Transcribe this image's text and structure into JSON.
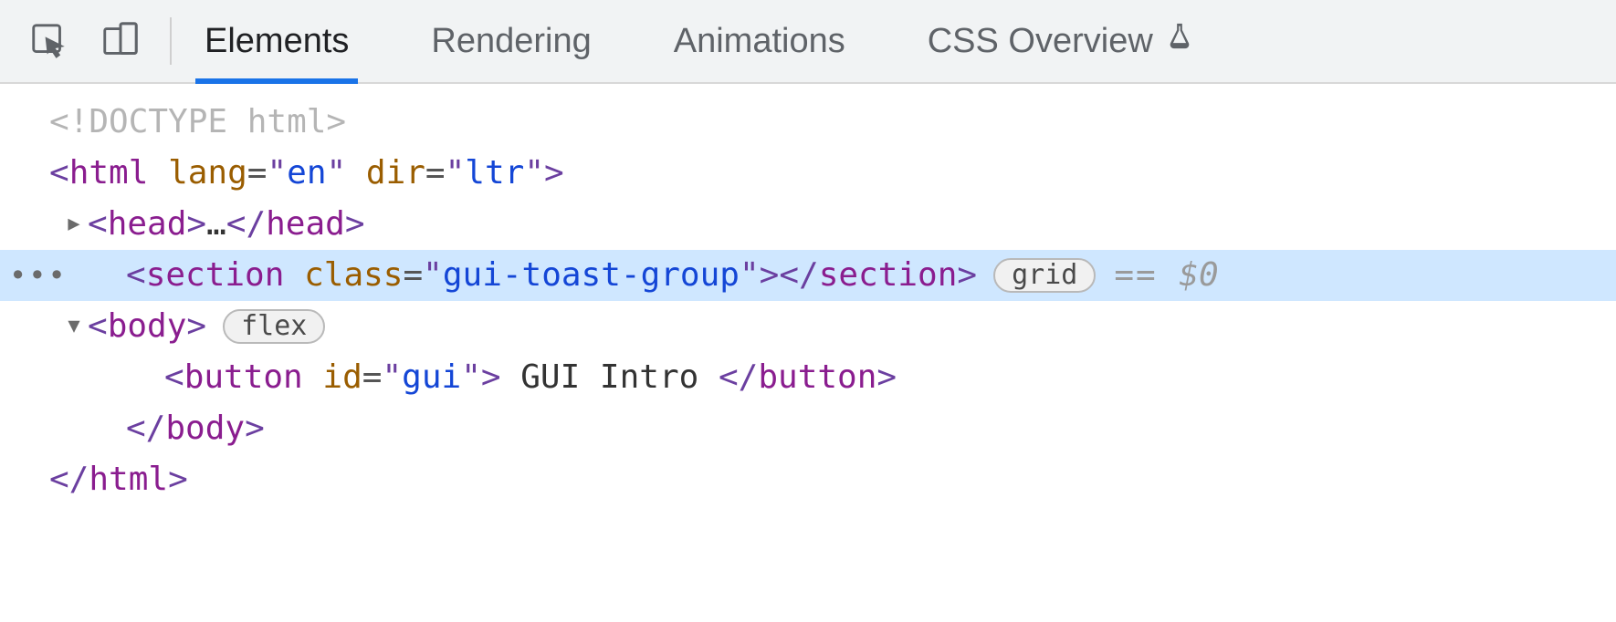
{
  "toolbar": {
    "tabs": {
      "elements": "Elements",
      "rendering": "Rendering",
      "animations": "Animations",
      "css_overview": "CSS Overview"
    }
  },
  "dom": {
    "doctype": "<!DOCTYPE html>",
    "html_open": {
      "tag": "html",
      "lang_attr": "lang",
      "lang_val": "en",
      "dir_attr": "dir",
      "dir_val": "ltr"
    },
    "head": {
      "tag_open": "head",
      "ellipsis": "…",
      "tag_close": "head"
    },
    "section": {
      "tag": "section",
      "class_attr": "class",
      "class_val": "gui-toast-group",
      "badge": "grid",
      "ref": "== $0"
    },
    "body_open": {
      "tag": "body",
      "badge": "flex"
    },
    "button": {
      "tag": "button",
      "id_attr": "id",
      "id_val": "gui",
      "text": " GUI Intro "
    },
    "body_close": "body",
    "html_close": "html"
  }
}
